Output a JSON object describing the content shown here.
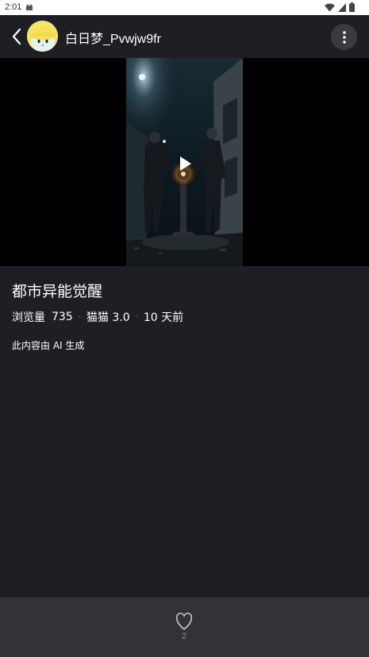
{
  "status_bar": {
    "time": "2:01",
    "icons": [
      "notification-icon",
      "wifi-icon",
      "signal-icon",
      "battery-icon"
    ]
  },
  "header": {
    "user_name": "白日梦_Pvwjw9fr",
    "avatar_icon": "avatar-image",
    "back_icon": "chevron-left-icon",
    "more_icon": "more-vertical-icon"
  },
  "video": {
    "play_icon": "play-icon"
  },
  "details": {
    "title": "都市异能觉醒",
    "views_label": "浏览量",
    "views_count": "735",
    "model": "猫猫 3.0",
    "time_ago": "10 天前",
    "ai_note": "此内容由 AI 生成"
  },
  "bottom_bar": {
    "like_icon": "heart-icon",
    "like_count": "2"
  },
  "colors": {
    "background": "#1f1e25",
    "bottom_bar": "#333239",
    "more_button": "#3b3a40",
    "secondary_text": "#8f8e95"
  }
}
